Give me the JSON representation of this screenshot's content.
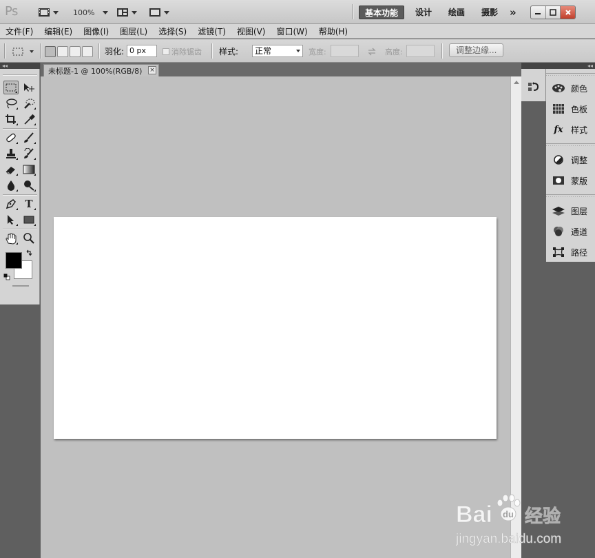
{
  "app": {
    "logo": "Ps",
    "zoom": "100%",
    "workspaces": [
      "基本功能",
      "设计",
      "绘画",
      "摄影"
    ],
    "active_workspace": "基本功能",
    "more_symbol": "»"
  },
  "menu": [
    "文件(F)",
    "编辑(E)",
    "图像(I)",
    "图层(L)",
    "选择(S)",
    "滤镜(T)",
    "视图(V)",
    "窗口(W)",
    "帮助(H)"
  ],
  "options": {
    "feather_label": "羽化:",
    "feather_value": "0 px",
    "antialias_label": "消除锯齿",
    "style_label": "样式:",
    "style_value": "正常",
    "width_label": "宽度:",
    "height_label": "高度:",
    "refine_edge": "调整边缘..."
  },
  "document": {
    "tab_title": "未标题-1 @ 100%(RGB/8)",
    "close_symbol": "×"
  },
  "colors": {
    "foreground": "#000000",
    "background": "#ffffff"
  },
  "panels": {
    "group1": [
      "颜色",
      "色板",
      "样式"
    ],
    "group2": [
      "调整",
      "蒙版"
    ],
    "group3": [
      "图层",
      "通道",
      "路径"
    ]
  },
  "watermark": {
    "brand": "Bai",
    "brand2": "du",
    "product": "经验",
    "url": "jingyan.baidu.com"
  }
}
